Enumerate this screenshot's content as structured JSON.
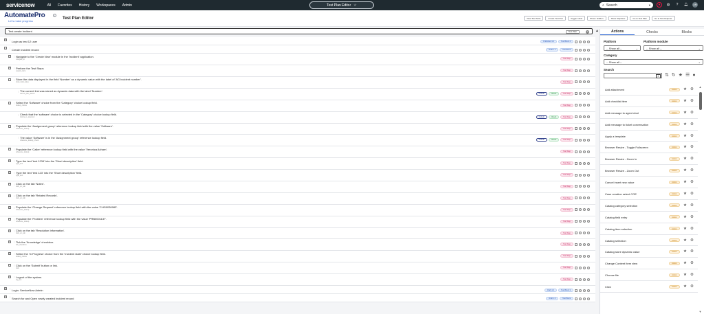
{
  "nav": {
    "logo": "servicenow",
    "menu": [
      "All",
      "Favorites",
      "History",
      "Workspaces",
      "Admin"
    ],
    "center_pill": "Test Plan Editor",
    "star_icon": "star-icon",
    "search_placeholder": "Search",
    "avatar_initials": "AM"
  },
  "header": {
    "brand": "AutomatePro",
    "tagline": "Let's make progress",
    "page_title": "Test Plan Editor",
    "buttons": [
      "View Test Suite",
      "Create Test Run",
      "Toggle Label",
      "Show / Hidden",
      "Show Stepdesc",
      "Go to Test Plan",
      "Go to Test Explorer"
    ]
  },
  "testbar": {
    "value": "Test create Incident",
    "tag": "Test Plan"
  },
  "steps": [
    {
      "level": 0,
      "toggle": "+",
      "label": "Login as test 12 user",
      "sub": "",
      "badges": [
        {
          "t": "Published 1.0",
          "c": "blue"
        },
        {
          "t": "Test Block 4",
          "c": "blue"
        }
      ]
    },
    {
      "level": 0,
      "toggle": "-",
      "label": "Create Incident record",
      "sub": "",
      "badges": [
        {
          "t": "Draft 1.1",
          "c": "blue"
        },
        {
          "t": "Test Block",
          "c": "blue"
        }
      ]
    },
    {
      "level": 1,
      "toggle": "+",
      "label": "Navigate to the 'Create New' module in the 'Incident' application.",
      "sub": "navigate_to",
      "badges": [
        {
          "t": "Test Step",
          "c": "pink"
        }
      ]
    },
    {
      "level": 1,
      "toggle": "+",
      "label": "Perform the Test Steps",
      "sub": "custom_form",
      "badges": [
        {
          "t": "Test Step",
          "c": "pink"
        }
      ]
    },
    {
      "level": 1,
      "toggle": "-",
      "label": "Store the data displayed in the field 'Number' as a dynamic value with the label of 'AG incident number'.",
      "sub": "store_field_value",
      "badges": [
        {
          "t": "Test Step",
          "c": "pink"
        }
      ]
    },
    {
      "level": 2,
      "toggle": "",
      "label": "The current link was stored as dynamic data with the label 'Number'.",
      "sub": "current_link_stored",
      "badges": [
        {
          "t": "Default",
          "c": "outl"
        },
        {
          "t": "Check",
          "c": "green"
        },
        {
          "t": "Test Step",
          "c": "pink"
        }
      ]
    },
    {
      "level": 1,
      "toggle": "-",
      "label": "Select the 'Software' choice from the 'Category' choice lookup field.",
      "sub": "lookup_choice",
      "badges": [
        {
          "t": "Test Step",
          "c": "pink"
        }
      ]
    },
    {
      "level": 2,
      "toggle": "",
      "label": "Check that the 'software' choice is selected in the 'Category' choice lookup field.",
      "sub": "choice_is_selected",
      "badges": [
        {
          "t": "Default",
          "c": "outl"
        },
        {
          "t": "Check",
          "c": "green"
        },
        {
          "t": "Test Step",
          "c": "pink"
        }
      ]
    },
    {
      "level": 1,
      "toggle": "-",
      "label": "Populate the 'Assignment group' reference lookup field with the value 'Software'.",
      "sub": "reference_lookup",
      "badges": [
        {
          "t": "Test Step",
          "c": "pink"
        }
      ]
    },
    {
      "level": 2,
      "toggle": "",
      "label": "The value 'Software' is in the 'Assignment group' reference lookup field.",
      "sub": "reference_lookup_check",
      "badges": [
        {
          "t": "Default",
          "c": "outl"
        },
        {
          "t": "Check",
          "c": "green"
        },
        {
          "t": "Test Step",
          "c": "pink"
        }
      ]
    },
    {
      "level": 1,
      "toggle": "+",
      "label": "Populate the 'Caller' reference lookup field with the value 'Veronica Acharn'.",
      "sub": "reference_lookup",
      "badges": [
        {
          "t": "Test Step",
          "c": "pink"
        }
      ]
    },
    {
      "level": 1,
      "toggle": "+",
      "label": "Type the text 'test 1234' into the 'Short description' field.",
      "sub": "type_text",
      "badges": [
        {
          "t": "Test Step",
          "c": "pink"
        }
      ]
    },
    {
      "level": 1,
      "toggle": "+",
      "label": "Type the text 'test 123' into the 'Short description' field.",
      "sub": "type_text",
      "badges": [
        {
          "t": "Test Step",
          "c": "pink"
        }
      ]
    },
    {
      "level": 1,
      "toggle": "+",
      "label": "Click on the tab 'Notes'.",
      "sub": "click_on_tab",
      "badges": [
        {
          "t": "Test Step",
          "c": "pink"
        }
      ]
    },
    {
      "level": 1,
      "toggle": "+",
      "label": "Click on the tab 'Related Records'.",
      "sub": "click_on_tab",
      "badges": [
        {
          "t": "Test Step",
          "c": "pink"
        }
      ]
    },
    {
      "level": 1,
      "toggle": "+",
      "label": "Populate the 'Change Request' reference lookup field with the value 'CHG0030063'.",
      "sub": "reference_lookup",
      "badges": [
        {
          "t": "Test Step",
          "c": "pink"
        }
      ]
    },
    {
      "level": 1,
      "toggle": "+",
      "label": "Populate the 'Problem' reference lookup field with the value 'PRB0001137'.",
      "sub": "reference_lookup",
      "badges": [
        {
          "t": "Test Step",
          "c": "pink"
        }
      ]
    },
    {
      "level": 1,
      "toggle": "+",
      "label": "Click on the tab 'Resolution Information'.",
      "sub": "click_on_tab",
      "badges": [
        {
          "t": "Test Step",
          "c": "pink"
        }
      ]
    },
    {
      "level": 1,
      "toggle": "+",
      "label": "Tick the 'Knowledge' checkbox.",
      "sub": "tick_checkbox",
      "badges": [
        {
          "t": "Test Step",
          "c": "pink"
        }
      ]
    },
    {
      "level": 1,
      "toggle": "+",
      "label": "Select the 'In Progress' choice from the 'Incident state' choice lookup field.",
      "sub": "lookup_choice",
      "badges": [
        {
          "t": "Test Step",
          "c": "pink"
        }
      ]
    },
    {
      "level": 1,
      "toggle": "+",
      "label": "Click on the 'Submit' button or link.",
      "sub": "click",
      "badges": [
        {
          "t": "Test Step",
          "c": "pink"
        }
      ]
    },
    {
      "level": 1,
      "toggle": "+",
      "label": "Logout of the system.",
      "sub": "log_out",
      "badges": [
        {
          "t": "Test Step",
          "c": "pink"
        }
      ]
    },
    {
      "level": 0,
      "toggle": "+",
      "label": "Login: ServiceNow Admin",
      "sub": "",
      "badges": [
        {
          "t": "Draft 1.0",
          "c": "blue"
        },
        {
          "t": "Test Block 3",
          "c": "blue"
        }
      ]
    },
    {
      "level": 0,
      "toggle": "+",
      "label": "Search for and Open newly created Incident record",
      "sub": "",
      "badges": [
        {
          "t": "Draft 1.0",
          "c": "blue"
        },
        {
          "t": "Test Block",
          "c": "blue"
        }
      ]
    }
  ],
  "panel": {
    "tabs": [
      "Actions",
      "Checks",
      "Blocks"
    ],
    "platform_label": "Platform",
    "platform_value": "-- Show all --",
    "module_label": "Platform module",
    "module_value": "-- Show all --",
    "category_label": "Category",
    "category_value": "-- Show all --",
    "search_label": "Search",
    "action_badge": "Action",
    "actions": [
      "Add attachment",
      "Add checklist item",
      "Add message to agent chat",
      "Add message to ticket conversation",
      "Apply a template",
      "Browser Resize - Toggle Fullscreen",
      "Browser Resize - Zoom In",
      "Browser Resize - Zoom Out",
      "Cancel insert new value",
      "Case creation select COE",
      "Catalog category selection",
      "Catalog field entry",
      "Catalog item selection",
      "Catalog selection",
      "Catalog store dynamic value",
      "Change Content Item view",
      "Choose file",
      "Click"
    ]
  }
}
